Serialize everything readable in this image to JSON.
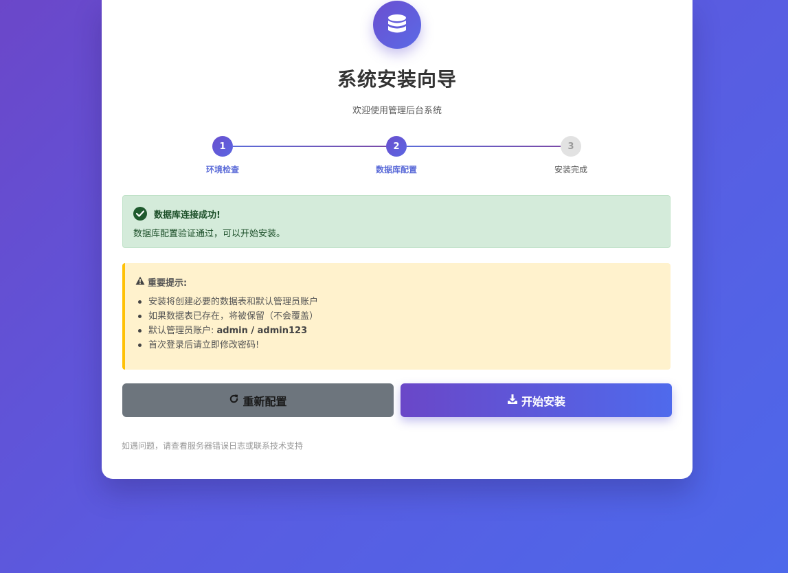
{
  "header": {
    "title": "系统安装向导",
    "subtitle": "欢迎使用管理后台系统",
    "logo_icon": "database-icon"
  },
  "steps": [
    {
      "number": "1",
      "label": "环境检查",
      "status": "active"
    },
    {
      "number": "2",
      "label": "数据库配置",
      "status": "active"
    },
    {
      "number": "3",
      "label": "安装完成",
      "status": "pending"
    }
  ],
  "success_alert": {
    "title": "数据库连接成功!",
    "message": "数据库配置验证通过，可以开始安装。",
    "icon": "check-circle-icon",
    "color": "#d4ebda"
  },
  "warning_alert": {
    "title": "重要提示:",
    "icon": "warning-icon",
    "items": [
      "安装将创建必要的数据表和默认管理员账户",
      "如果数据表已存在，将被保留（不会覆盖）",
      "首次登录后请立即修改密码!"
    ],
    "account_label": "默认管理员账户: ",
    "account_credentials": "admin / admin123",
    "color": "#fff2cd",
    "border_color": "#ffc107"
  },
  "buttons": {
    "reset_label": "重新配置",
    "reset_icon": "refresh-icon",
    "install_label": "开始安装",
    "install_icon": "download-icon"
  },
  "footer": {
    "note": "如遇问题，请查看服务器错误日志或联系技术支持"
  },
  "colors": {
    "accent": "#5b6bd8",
    "background_start": "#6b47c9",
    "background_end": "#4d68ea"
  }
}
